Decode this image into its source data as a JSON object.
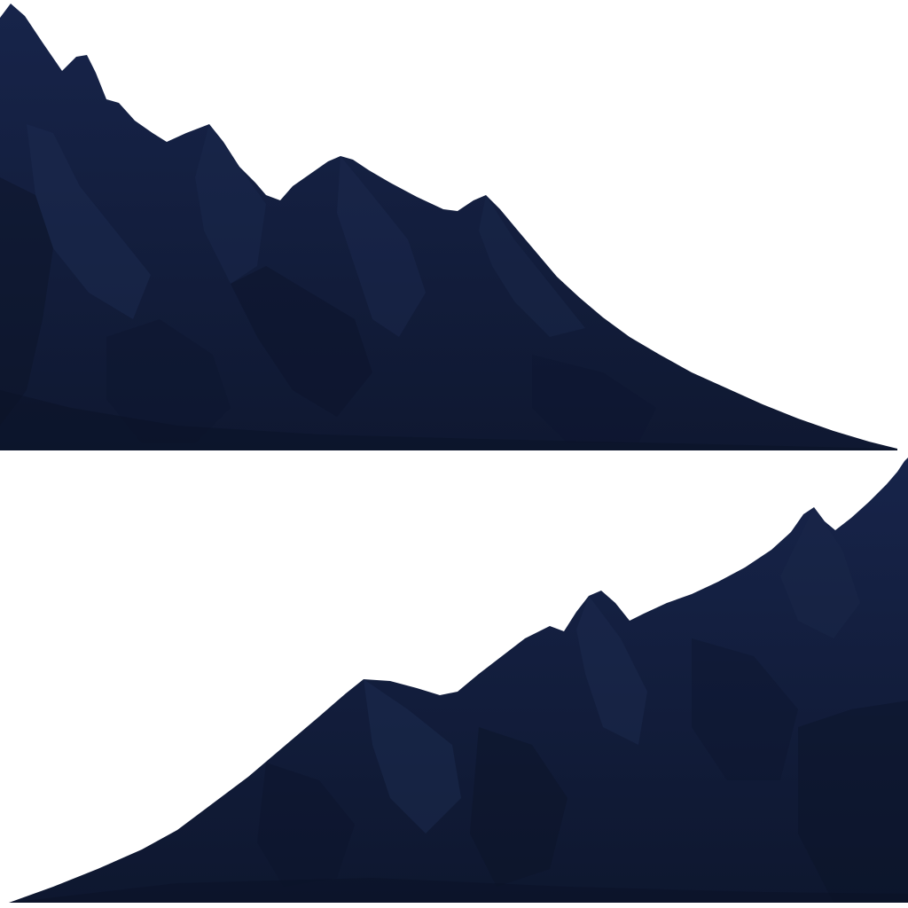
{
  "scene": {
    "description_free": true,
    "colors": {
      "background": "#ffffff",
      "mountain_base": "#111c38",
      "mountain_light": "#1b2a4d",
      "mountain_shadow": "#0c1429",
      "mountain_dark": "#0a1124"
    }
  }
}
